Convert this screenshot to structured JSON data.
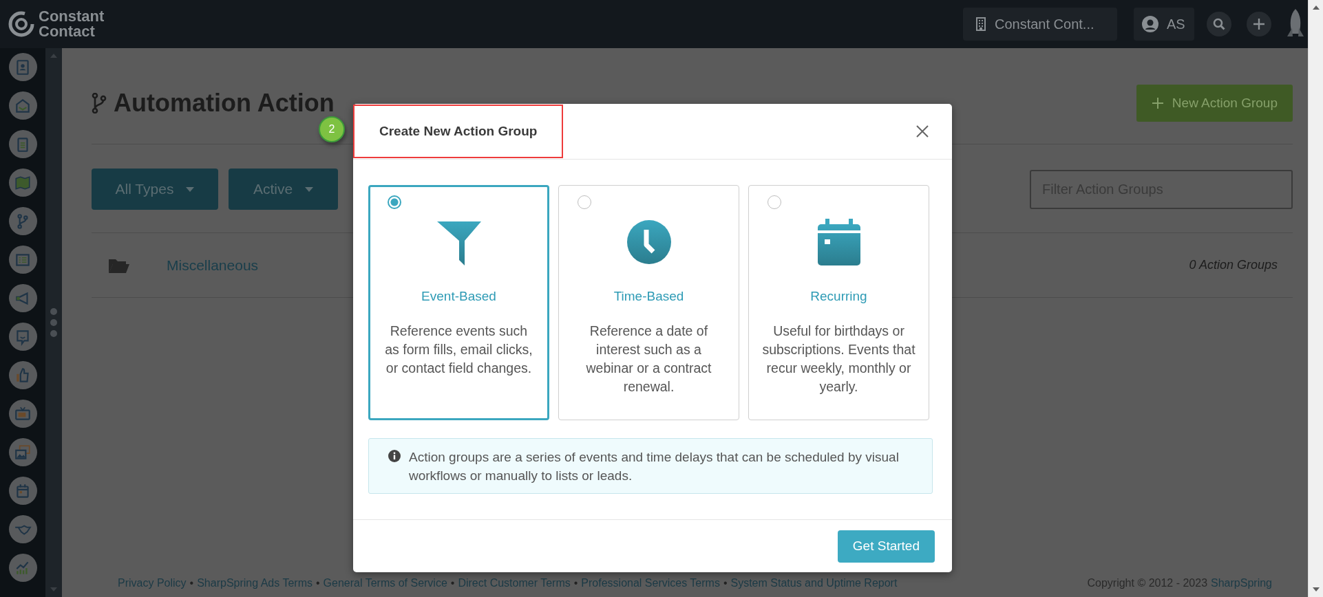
{
  "topbar": {
    "logo_lines": [
      "Constant",
      "Contact"
    ],
    "account_button": "Constant Cont...",
    "user_initials": "AS"
  },
  "page": {
    "title": "Automation Action",
    "new_button": "New Action Group",
    "filters": [
      {
        "label": "All Types"
      },
      {
        "label": "Active"
      }
    ],
    "filter_field": {
      "placeholder": "Filter Action Groups"
    },
    "folders": [
      {
        "name": "Miscellaneous",
        "count": "0 Action Groups"
      }
    ]
  },
  "footer": {
    "links": [
      "Privacy Policy",
      "SharpSpring Ads Terms",
      "General Terms of Service",
      "Direct Customer Terms",
      "Professional Services Terms",
      "System Status and Uptime Report"
    ],
    "separator": "•",
    "copyright": "Copyright © 2012 - 2023",
    "copyright_link": "SharpSpring"
  },
  "modal": {
    "step_badge": "2",
    "title": "Create New Action Group",
    "title_highlighted": true,
    "options": [
      {
        "kind": "funnel",
        "title": "Event-Based",
        "description": "Reference events such as form fills, email clicks, or contact field changes.",
        "selected": true
      },
      {
        "kind": "clock",
        "title": "Time-Based",
        "description": "Reference a date of interest such as a webinar or a contract renewal.",
        "selected": false
      },
      {
        "kind": "calendar",
        "title": "Recurring",
        "description": "Useful for birthdays or subscriptions. Events that recur weekly, monthly or yearly.",
        "selected": false
      }
    ],
    "info": "Action groups are a series of events and time delays that can be scheduled by visual workflows or manually to lists or leads.",
    "button": "Get Started"
  }
}
